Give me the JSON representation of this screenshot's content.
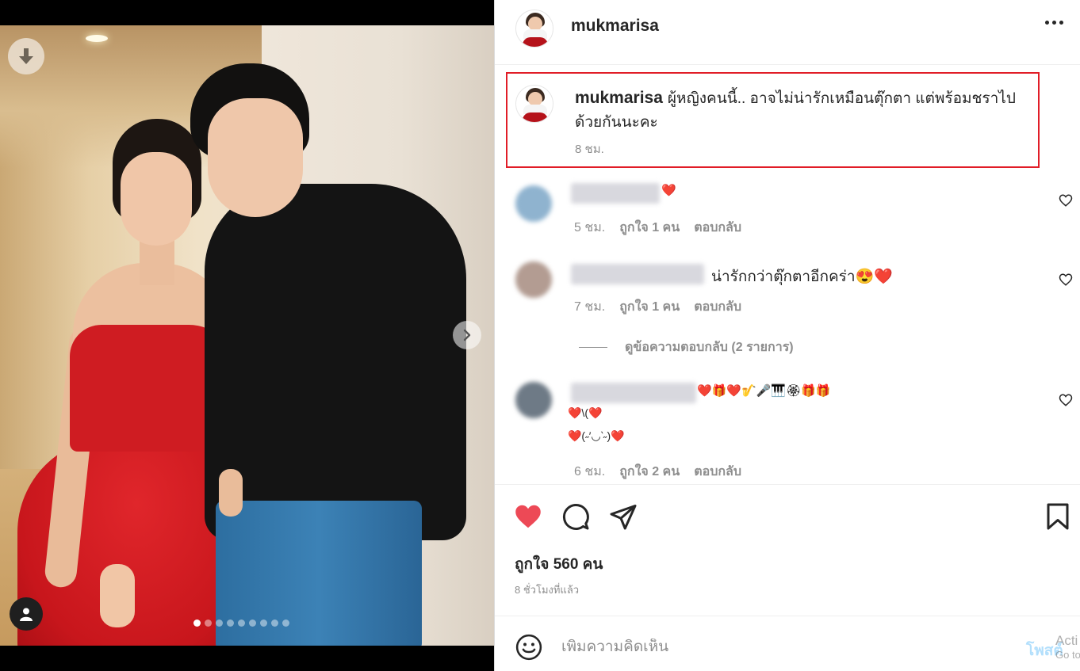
{
  "post": {
    "username": "mukmarisa",
    "caption": "ผู้หญิงคนนี้.. อาจไม่น่ารักเหมือนตุ๊กตา แต่พร้อมชราไปด้วยกันนะคะ",
    "caption_time": "8 ชม."
  },
  "carousel": {
    "total": 9,
    "active_index": 0
  },
  "comments": [
    {
      "text": "❤️",
      "time": "5 ชม.",
      "likes": "ถูกใจ 1 คน",
      "reply": "ตอบกลับ"
    },
    {
      "text": "น่ารักกว่าตุ๊กตาอีกคร่า😍❤️",
      "time": "7 ชม.",
      "likes": "ถูกใจ 1 คน",
      "reply": "ตอบกลับ"
    },
    {
      "text": "❤️🎁❤️🎷🎤🎹🏵🎁🎁",
      "line2": "❤️\\(❤️",
      "line3": "❤️(˶′◡‵˶)❤️",
      "time": "6 ชม.",
      "likes": "ถูกใจ 2 คน",
      "reply": "ตอบกลับ"
    }
  ],
  "view_replies": "ดูข้อความตอบกลับ (2 รายการ)",
  "likes_count": "ถูกใจ 560 คน",
  "posted_ago": "8 ชั่วโมงที่แล้ว",
  "add_comment": {
    "placeholder": "เพิ่มความคิดเห็น",
    "post_label": "โพสต์"
  },
  "watermark": {
    "line1": "Acti",
    "line2": "Go to"
  },
  "colors": {
    "like_red": "#ed4956",
    "highlight_box": "#e11d27",
    "post_blue": "#b2dffc"
  },
  "icons": [
    "download-icon",
    "chevron-right-icon",
    "user-tag-icon",
    "more-icon",
    "heart-icon",
    "comment-icon",
    "share-icon",
    "bookmark-icon",
    "emoji-icon"
  ]
}
